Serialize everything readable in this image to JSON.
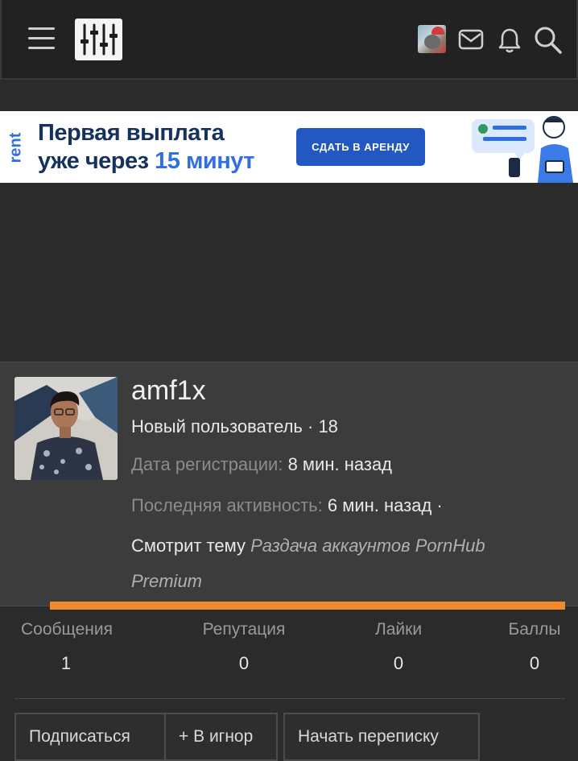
{
  "header": {
    "menu_icon": "hamburger-icon",
    "logo_icon": "sliders-logo-icon",
    "icons": [
      "user-avatar",
      "envelope-icon",
      "bell-icon",
      "search-icon"
    ]
  },
  "banner": {
    "brand": "rent",
    "line1": "Первая выплата",
    "line2_prefix": "уже через",
    "line2_accent": "15 минут",
    "button_label": "СДАТЬ В АРЕНДУ"
  },
  "profile": {
    "username": "amf1x",
    "title": "Новый пользователь · 18",
    "registered_label": "Дата регистрации:",
    "registered_value": "8 мин. назад",
    "activity_label": "Последняя активность:",
    "activity_value": "6 мин. назад ·",
    "watching_prefix": "Смотрит тему",
    "watching_topic": "Раздача аккаунтов PornHub Premium"
  },
  "stats": [
    {
      "label": "Сообщения",
      "value": "1"
    },
    {
      "label": "Репутация",
      "value": "0"
    },
    {
      "label": "Лайки",
      "value": "0"
    },
    {
      "label": "Баллы",
      "value": "0"
    }
  ],
  "actions": {
    "follow": "Подписаться",
    "ignore": "+ В игнор",
    "message": "Начать переписку"
  },
  "colors": {
    "accent_orange": "#f08a2c",
    "banner_button": "#2357c2",
    "background": "#2b2b2b"
  }
}
